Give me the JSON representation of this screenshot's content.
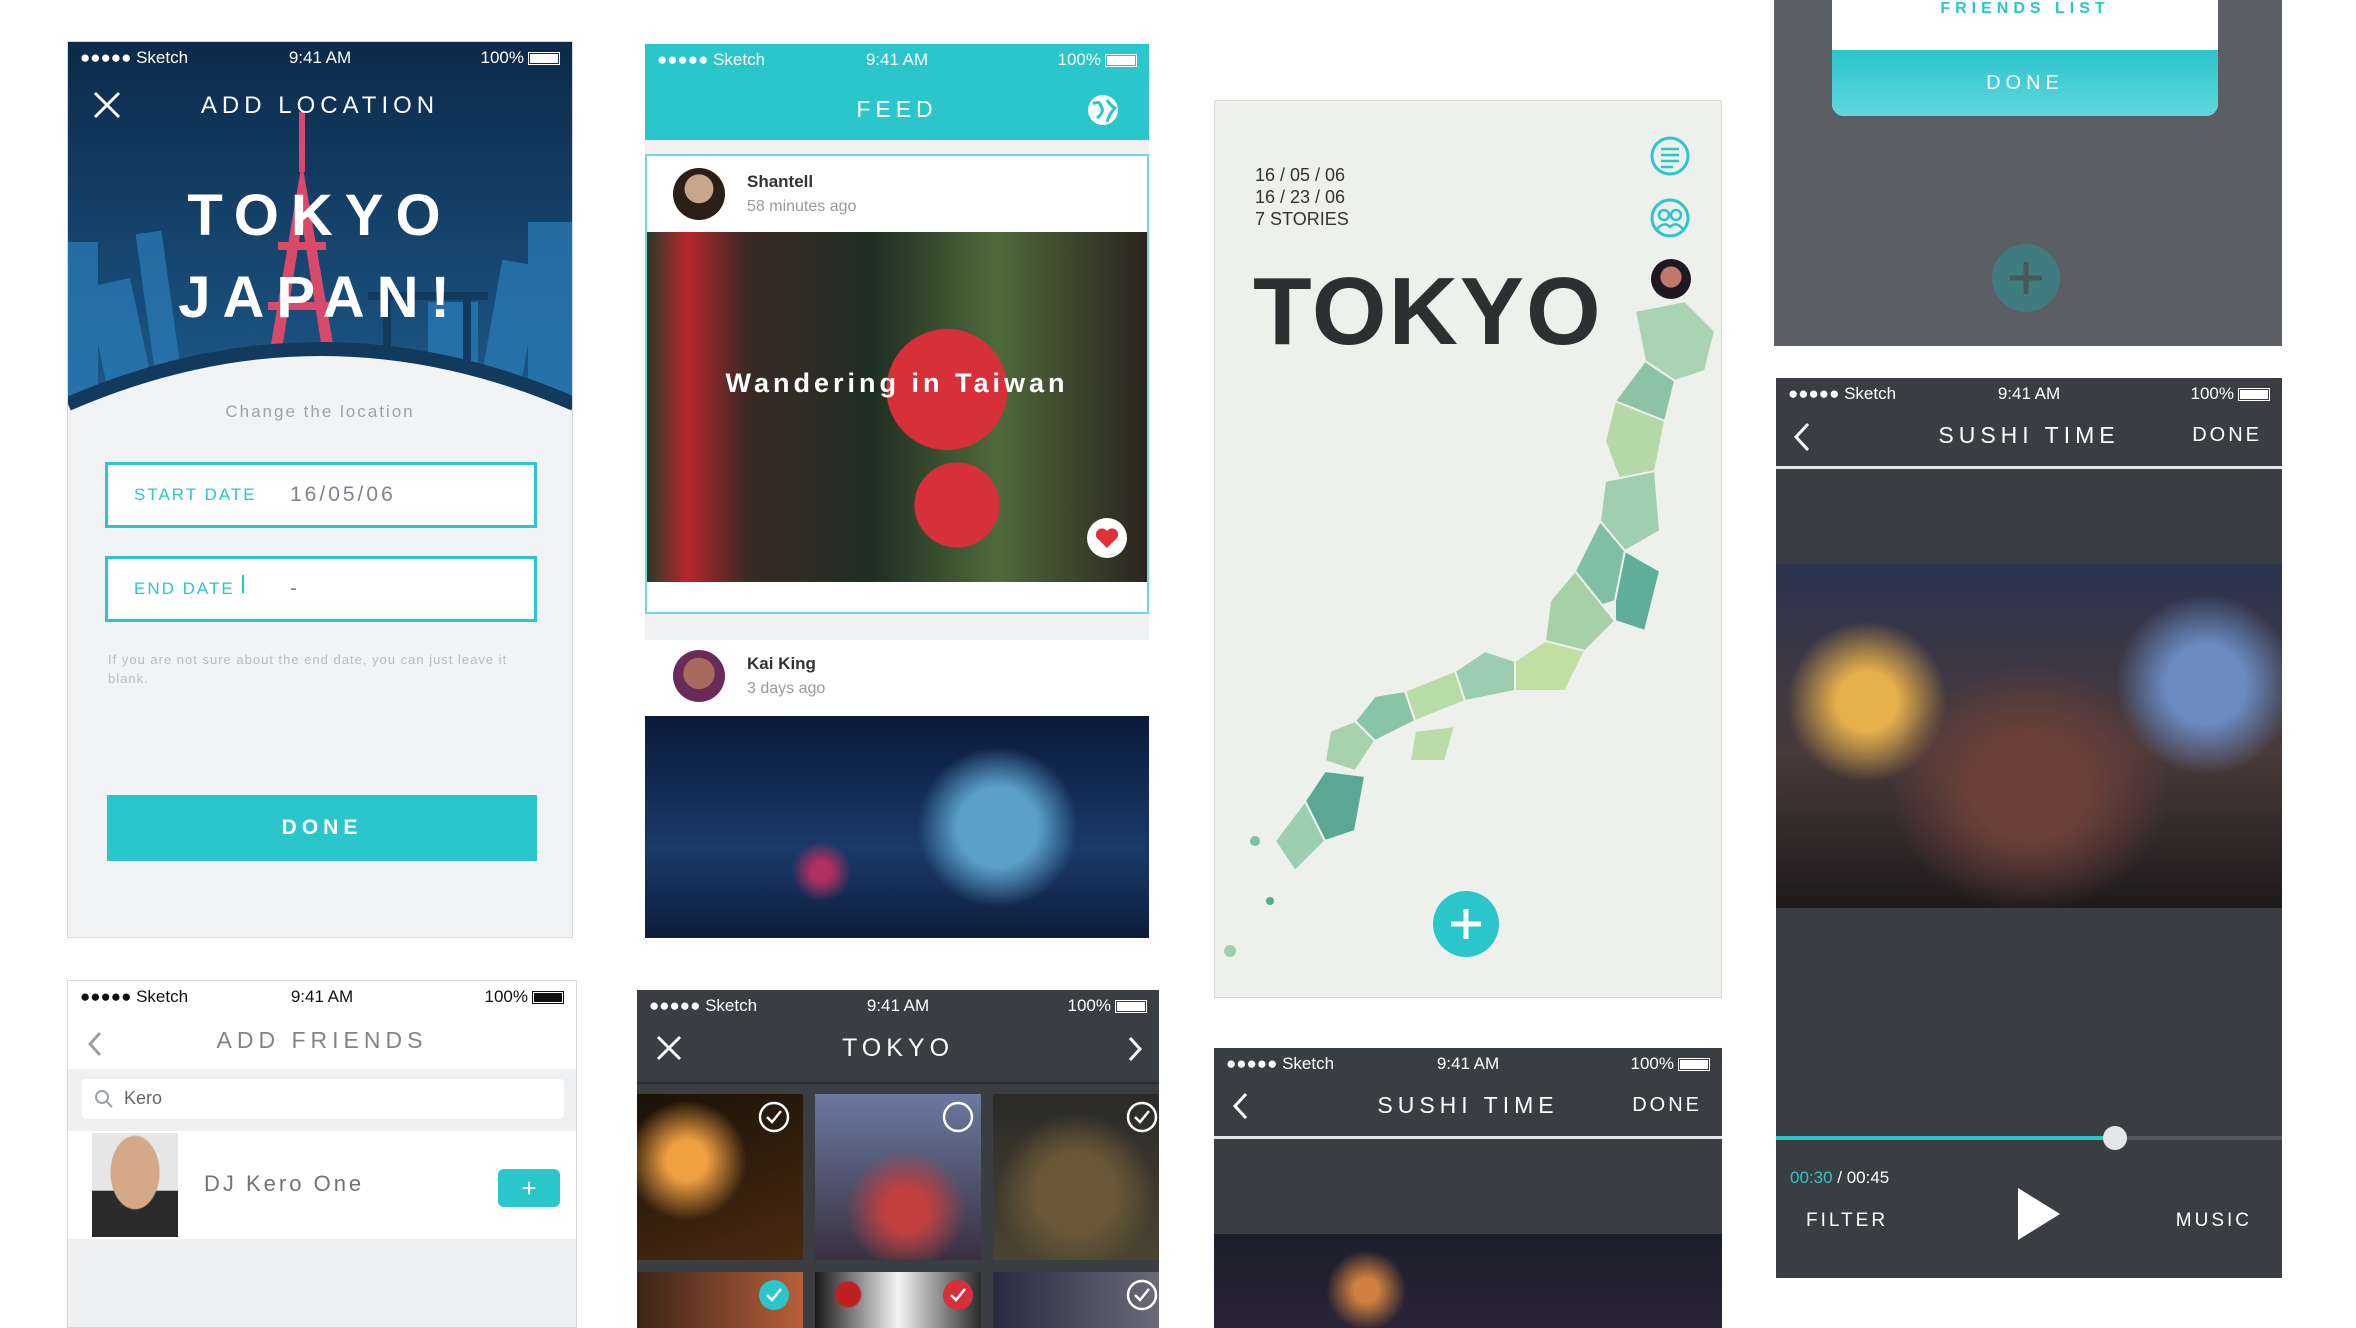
{
  "status": {
    "carrier": "●●●●● Sketch",
    "time": "9:41 AM",
    "battery": "100%"
  },
  "add_location": {
    "title": "ADD LOCATION",
    "city": "TOKYO",
    "country": "JAPAN!",
    "change": "Change the location",
    "start_label": "START DATE",
    "start_value": "16/05/06",
    "end_label": "END DATE",
    "end_value": "-",
    "hint": "If you are not sure about the end date, you can just leave it blank.",
    "done": "DONE"
  },
  "feed": {
    "title": "FEED",
    "posts": [
      {
        "user": "Shantell",
        "time": "58 minutes ago",
        "image_caption": "Wandering in Taiwan"
      },
      {
        "user": "Kai King",
        "time": "3 days ago"
      }
    ]
  },
  "map_screen": {
    "date1": "16 / 05 / 06",
    "date2": "16 / 23 / 06",
    "stories": "7 STORIES",
    "city": "TOKYO"
  },
  "friends_popup": {
    "title": "FRIENDS LIST",
    "done": "DONE"
  },
  "sushi_video": {
    "title": "SUSHI TIME",
    "done": "DONE",
    "current": "00:30",
    "total": " / 00:45",
    "progress": 0.67,
    "filter": "FILTER",
    "music": "MUSIC"
  },
  "add_friends": {
    "title": "ADD FRIENDS",
    "search": "Kero",
    "friend": "DJ Kero One",
    "add": "+"
  },
  "gallery": {
    "title": "TOKYO"
  },
  "sushi_small": {
    "title": "SUSHI TIME",
    "done": "DONE"
  },
  "colors": {
    "teal": "#2bc5cc",
    "dark": "#3b3f44",
    "navy": "#123a5c"
  }
}
